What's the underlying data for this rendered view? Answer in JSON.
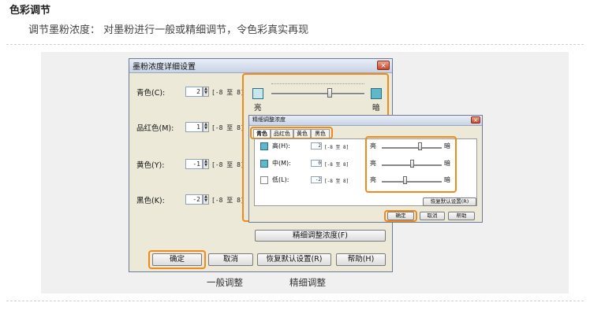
{
  "section": {
    "title": "色彩调节",
    "description": "调节墨粉浓度： 对墨粉进行一般或精细调节，令色彩真实再现"
  },
  "main_dialog": {
    "title": "墨粉浓度详细设置",
    "close": "×",
    "rows": [
      {
        "label": "青色(C):",
        "value": "2",
        "range": "[-8 至 8]"
      },
      {
        "label": "品红色(M):",
        "value": "1",
        "range": "[-8 至 8]"
      },
      {
        "label": "黄色(Y):",
        "value": "-1",
        "range": "[-8 至 8]"
      },
      {
        "label": "黑色(K):",
        "value": "-2",
        "range": "[-8 至 8]"
      }
    ],
    "slider": {
      "left_label": "亮",
      "right_label": "暗",
      "value": 2,
      "min": -8,
      "max": 8
    },
    "fine_adjust_button": "精细调整浓度(F)",
    "buttons": {
      "ok": "确定",
      "cancel": "取消",
      "restore": "恢复默认设置(R)",
      "help": "帮助(H)"
    }
  },
  "fine_dialog": {
    "title": "精细调整浓度",
    "close": "×",
    "tabs": [
      "青色",
      "品红色",
      "黄色",
      "黑色"
    ],
    "active_tab": "青色",
    "rows": [
      {
        "label": "高(H):",
        "value": "2",
        "range": "[-8 至 8]",
        "left": "亮",
        "right": "暗",
        "level": 2
      },
      {
        "label": "中(M):",
        "value": "0",
        "range": "[-8 至 8]",
        "left": "亮",
        "right": "暗",
        "level": 0
      },
      {
        "label": "低(L):",
        "value": "-2",
        "range": "[-8 至 8]",
        "left": "亮",
        "right": "暗",
        "level": -2
      }
    ],
    "restore_button": "恢复默认设置(R)",
    "buttons": {
      "ok": "确定",
      "cancel": "取消",
      "help": "帮助"
    }
  },
  "captions": {
    "general": "一般调整",
    "fine": "精细调整"
  },
  "colors": {
    "highlight": "#f08a1c",
    "swatch": "#5fb8c9"
  },
  "icons": {
    "spin_up": "▲",
    "spin_down": "▼"
  }
}
